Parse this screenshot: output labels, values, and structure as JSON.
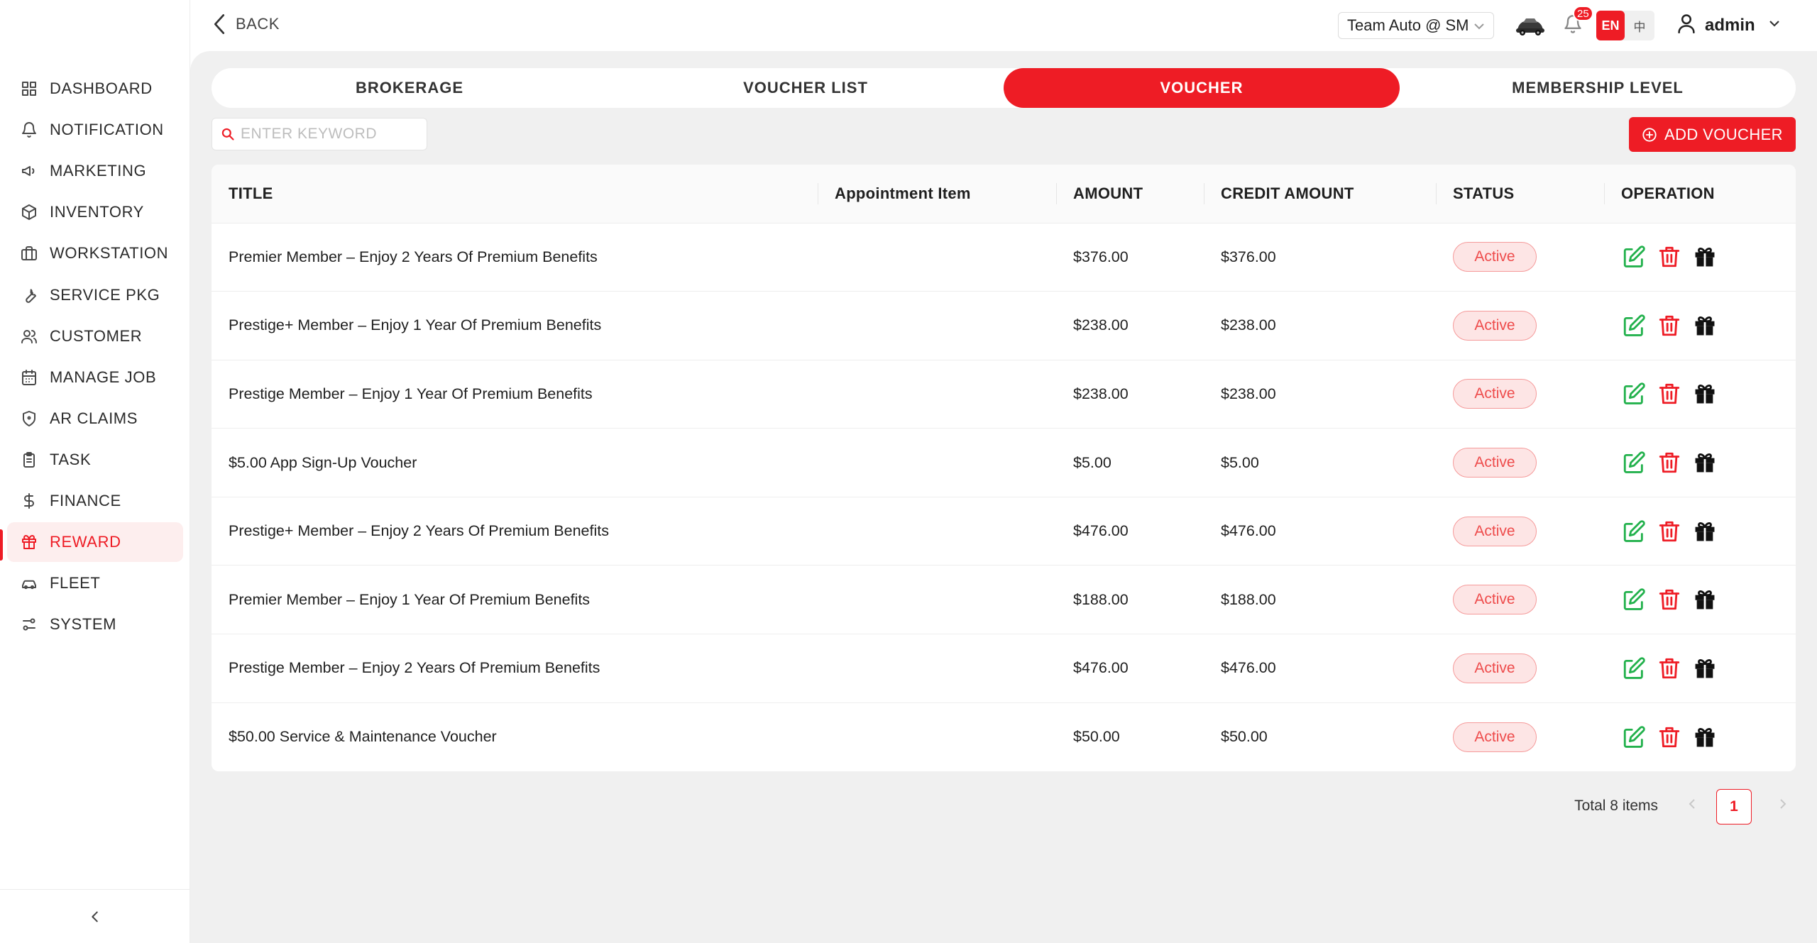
{
  "sidebar": {
    "items": [
      {
        "label": "DASHBOARD",
        "icon": "dashboard-icon"
      },
      {
        "label": "NOTIFICATION",
        "icon": "bell-icon"
      },
      {
        "label": "MARKETING",
        "icon": "megaphone-icon"
      },
      {
        "label": "INVENTORY",
        "icon": "box-icon"
      },
      {
        "label": "WORKSTATION",
        "icon": "briefcase-icon"
      },
      {
        "label": "SERVICE PKG",
        "icon": "wrench-icon"
      },
      {
        "label": "CUSTOMER",
        "icon": "users-icon"
      },
      {
        "label": "MANAGE JOB",
        "icon": "calendar-icon"
      },
      {
        "label": "AR CLAIMS",
        "icon": "shield-icon"
      },
      {
        "label": "TASK",
        "icon": "clipboard-icon"
      },
      {
        "label": "FINANCE",
        "icon": "dollar-icon"
      },
      {
        "label": "REWARD",
        "icon": "gift-icon"
      },
      {
        "label": "FLEET",
        "icon": "car-icon"
      },
      {
        "label": "SYSTEM",
        "icon": "sliders-icon"
      }
    ],
    "active": "REWARD"
  },
  "header": {
    "back_label": "BACK",
    "company": "Team Auto @ SM",
    "notification_count": "25",
    "lang_en": "EN",
    "lang_zh": "中",
    "user": "admin"
  },
  "tabs": [
    {
      "label": "BROKERAGE"
    },
    {
      "label": "VOUCHER LIST"
    },
    {
      "label": "VOUCHER"
    },
    {
      "label": "MEMBERSHIP LEVEL"
    }
  ],
  "active_tab": "VOUCHER",
  "search": {
    "placeholder": "ENTER KEYWORD",
    "value": ""
  },
  "add_button_label": "ADD VOUCHER",
  "table": {
    "columns": [
      "TITLE",
      "Appointment Item",
      "AMOUNT",
      "CREDIT AMOUNT",
      "STATUS",
      "OPERATION"
    ],
    "rows": [
      {
        "title": "Premier Member – Enjoy 2 Years Of Premium Benefits",
        "appointment_item": "",
        "amount": "$376.00",
        "credit_amount": "$376.00",
        "status": "Active"
      },
      {
        "title": "Prestige+ Member – Enjoy 1 Year Of Premium Benefits",
        "appointment_item": "",
        "amount": "$238.00",
        "credit_amount": "$238.00",
        "status": "Active"
      },
      {
        "title": "Prestige Member – Enjoy 1 Year Of Premium Benefits",
        "appointment_item": "",
        "amount": "$238.00",
        "credit_amount": "$238.00",
        "status": "Active"
      },
      {
        "title": "$5.00 App Sign-Up Voucher",
        "appointment_item": "",
        "amount": "$5.00",
        "credit_amount": "$5.00",
        "status": "Active"
      },
      {
        "title": "Prestige+ Member – Enjoy 2 Years Of Premium Benefits",
        "appointment_item": "",
        "amount": "$476.00",
        "credit_amount": "$476.00",
        "status": "Active"
      },
      {
        "title": "Premier Member – Enjoy 1 Year Of Premium Benefits",
        "appointment_item": "",
        "amount": "$188.00",
        "credit_amount": "$188.00",
        "status": "Active"
      },
      {
        "title": "Prestige Member – Enjoy 2 Years Of Premium Benefits",
        "appointment_item": "",
        "amount": "$476.00",
        "credit_amount": "$476.00",
        "status": "Active"
      },
      {
        "title": "$50.00 Service & Maintenance Voucher",
        "appointment_item": "",
        "amount": "$50.00",
        "credit_amount": "$50.00",
        "status": "Active"
      }
    ]
  },
  "pagination": {
    "total_text": "Total 8 items",
    "current_page": "1"
  },
  "colors": {
    "accent": "#ee1c25",
    "edit_green": "#22b14c",
    "delete_red": "#ee1c25",
    "status_bg": "#fde5e5"
  }
}
